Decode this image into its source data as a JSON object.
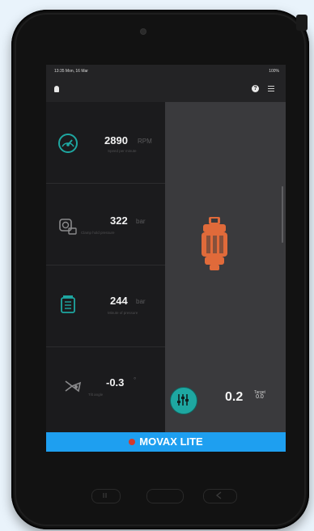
{
  "status_bar": {
    "left_text": "13:35 Mon, 16 Mar",
    "right_text": "100%"
  },
  "app_bar": {
    "logo_icon": "movax-logo-icon",
    "help_icon": "question-icon",
    "menu_icon": "menu-icon",
    "help_glyph": "?"
  },
  "metrics": [
    {
      "icon": "speedometer-icon",
      "value": "2890",
      "unit": "RPM",
      "caption": "Speed per minute"
    },
    {
      "icon": "pressure-gauge-icon",
      "value": "322",
      "unit": "bar",
      "caption": "Clamp hold pressure"
    },
    {
      "icon": "hydraulic-icon",
      "value": "244",
      "unit": "bar",
      "caption": "Minute of pressure"
    },
    {
      "icon": "tilt-icon",
      "value": "-0.3",
      "unit": "°",
      "caption": "Tilt angle"
    }
  ],
  "target": {
    "value": "0.2",
    "label": "Target",
    "sub_value": "0.0"
  },
  "brand": {
    "name": "MOVAX LITE",
    "bar_color": "#1e9ff0",
    "logo_color": "#d43a2b"
  },
  "accent_color": "#1ea7a1",
  "device_color": "#e06a3a"
}
